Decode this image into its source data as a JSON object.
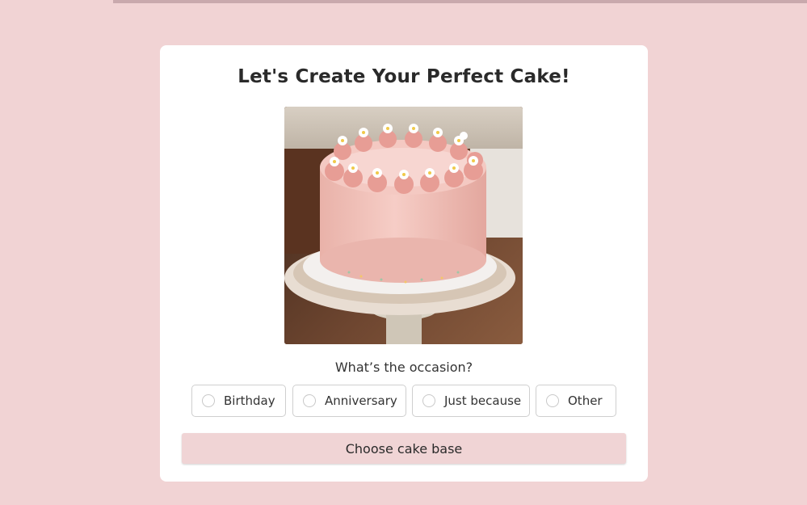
{
  "progress": {
    "color": "#c9a9ad"
  },
  "colors": {
    "page_background": "#f1d3d4",
    "card_background": "#ffffff",
    "button_background": "#f0d4d5"
  },
  "card": {
    "title": "Let's Create Your Perfect Cake!",
    "image": {
      "alt": "Pink frosted layer cake with piped rosettes and small white flowers on a cake stand"
    },
    "question": "What’s the occasion?",
    "options": [
      {
        "label": "Birthday",
        "selected": false
      },
      {
        "label": "Anniversary",
        "selected": false
      },
      {
        "label": "Just because",
        "selected": false
      },
      {
        "label": "Other",
        "selected": false
      }
    ],
    "submit_label": "Choose cake base"
  }
}
